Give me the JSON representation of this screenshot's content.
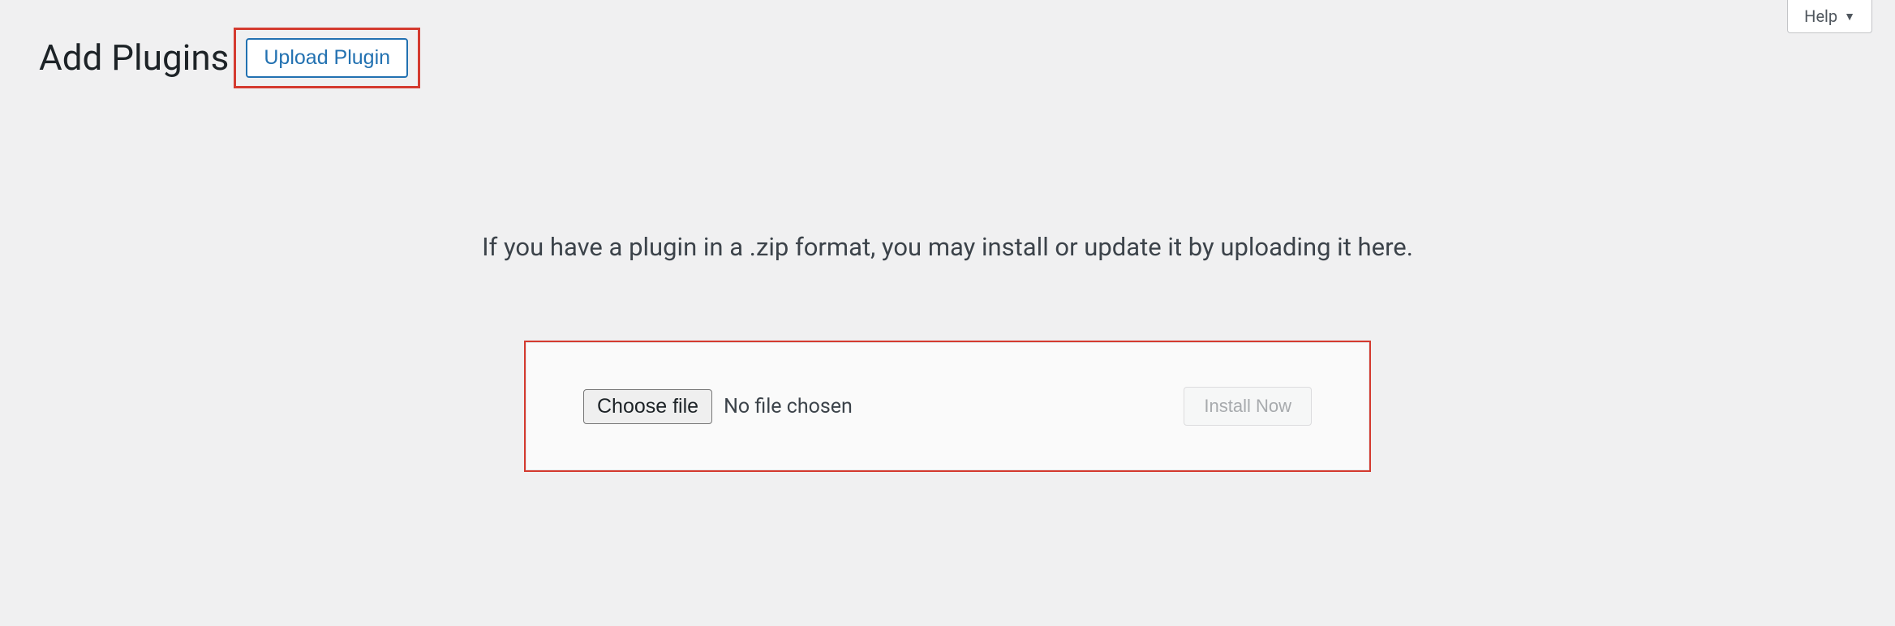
{
  "help": {
    "label": "Help"
  },
  "header": {
    "title": "Add Plugins",
    "upload_button": "Upload Plugin"
  },
  "instruction": "If you have a plugin in a .zip format, you may install or update it by uploading it here.",
  "upload_form": {
    "choose_file_label": "Choose file",
    "file_status": "No file chosen",
    "install_button": "Install Now"
  }
}
